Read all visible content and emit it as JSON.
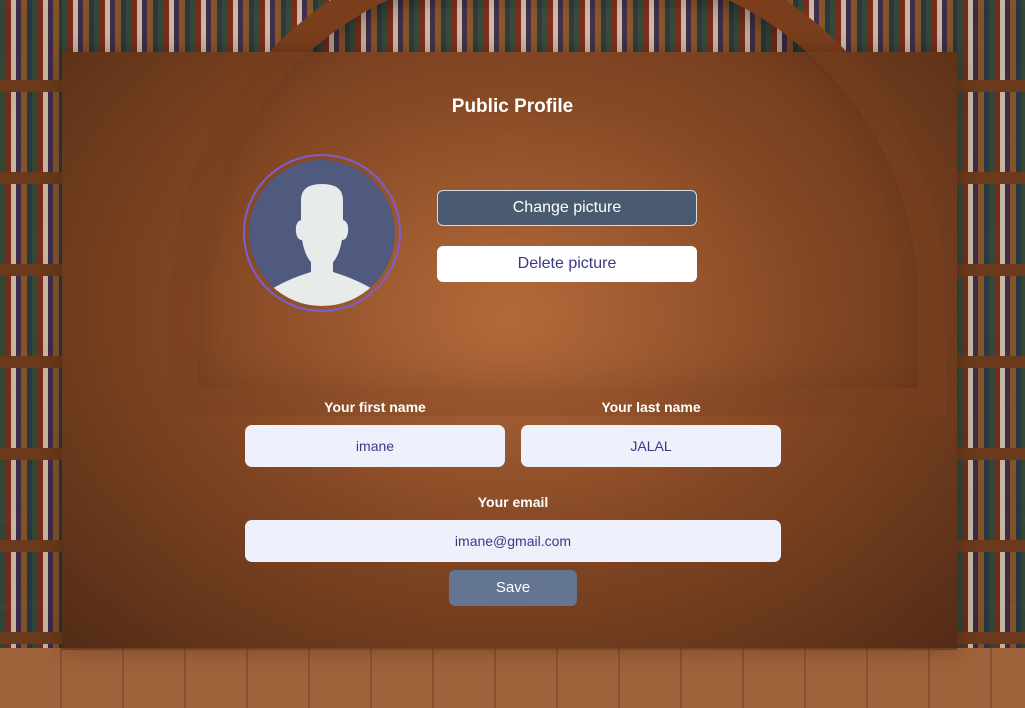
{
  "profile": {
    "title": "Public Profile",
    "change_picture_label": "Change picture",
    "delete_picture_label": "Delete picture",
    "first_name_label": "Your first name",
    "first_name_value": "imane",
    "last_name_label": "Your last name",
    "last_name_value": "JALAL",
    "email_label": "Your email",
    "email_value": "imane@gmail.com",
    "save_label": "Save"
  },
  "icons": {
    "avatar": "user-silhouette-icon"
  },
  "colors": {
    "change_button_bg": "#4a5a70",
    "delete_button_bg": "#ffffff",
    "field_bg": "#eef0fc",
    "field_text": "#3a3a82",
    "save_button_bg": "#637590",
    "avatar_ring": "#7b5fd0",
    "avatar_bg": "#4f5a7e"
  }
}
